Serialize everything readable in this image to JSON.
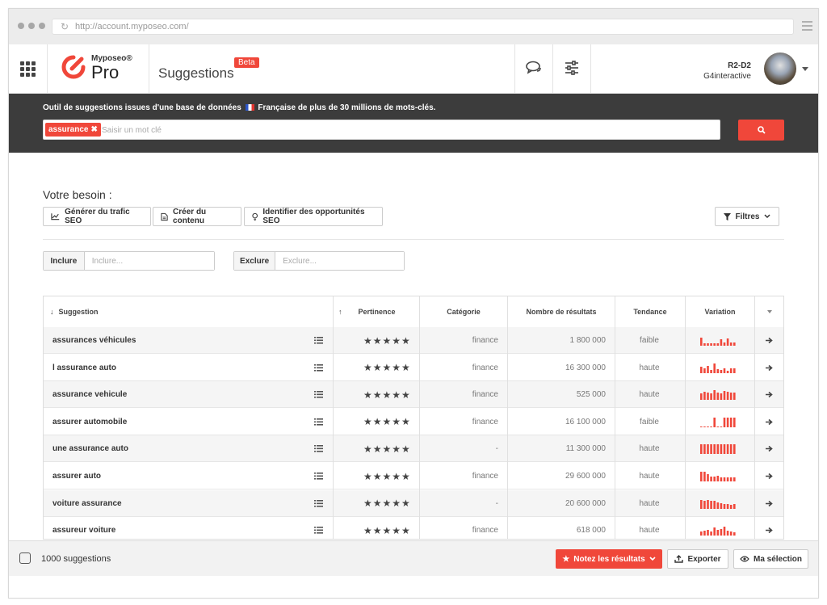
{
  "browser": {
    "url": "http://account.myposeo.com/"
  },
  "header": {
    "brand": "Myposeo®",
    "product": "Pro",
    "page_title": "Suggestions",
    "beta_badge": "Beta",
    "user_name": "R2-D2",
    "user_org": "G4interactive"
  },
  "search": {
    "description_before": "Outil de suggestions issues d'une base de données",
    "description_after": "Française de plus de 30 millions de mots-clés.",
    "tag": "assurance",
    "placeholder": "Saisir un mot clé"
  },
  "needs": {
    "title": "Votre besoin :",
    "buttons": [
      "Générer du trafic SEO",
      "Créer du contenu",
      "Identifier des opportunités SEO"
    ],
    "filters_label": "Filtres"
  },
  "filters": {
    "include_label": "Inclure",
    "include_placeholder": "Inclure...",
    "exclude_label": "Exclure",
    "exclude_placeholder": "Exclure..."
  },
  "table": {
    "columns": [
      "Suggestion",
      "Pertinence",
      "Catégorie",
      "Nombre de résultats",
      "Tendance",
      "Variation"
    ],
    "rows": [
      {
        "suggestion": "assurances véhicules",
        "stars": "★★★★★",
        "category": "finance",
        "results": "1 800 000",
        "trend": "faible",
        "variation": [
          10,
          3,
          3,
          3,
          3,
          3,
          8,
          4,
          9,
          4,
          4
        ]
      },
      {
        "suggestion": "l assurance auto",
        "stars": "★★★★★",
        "category": "finance",
        "results": "16 300 000",
        "trend": "haute",
        "variation": [
          8,
          6,
          9,
          4,
          12,
          5,
          4,
          6,
          3,
          6,
          6
        ]
      },
      {
        "suggestion": "assurance vehicule",
        "stars": "★★★★★",
        "category": "finance",
        "results": "525 000",
        "trend": "haute",
        "variation": [
          8,
          10,
          9,
          8,
          12,
          9,
          8,
          11,
          10,
          9,
          9
        ]
      },
      {
        "suggestion": "assurer automobile",
        "stars": "★★★★★",
        "category": "finance",
        "results": "16 100 000",
        "trend": "faible",
        "variation": [
          1,
          1,
          1,
          1,
          12,
          1,
          1,
          12,
          12,
          12,
          12
        ]
      },
      {
        "suggestion": "une assurance auto",
        "stars": "★★★★★",
        "category": "-",
        "results": "11 300 000",
        "trend": "haute",
        "variation": [
          12,
          12,
          12,
          12,
          12,
          12,
          12,
          12,
          12,
          12,
          12
        ]
      },
      {
        "suggestion": "assurer auto",
        "stars": "★★★★★",
        "category": "finance",
        "results": "29 600 000",
        "trend": "haute",
        "variation": [
          12,
          12,
          9,
          6,
          6,
          7,
          5,
          5,
          5,
          5,
          5
        ]
      },
      {
        "suggestion": "voiture assurance",
        "stars": "★★★★★",
        "category": "-",
        "results": "20 600 000",
        "trend": "haute",
        "variation": [
          11,
          10,
          11,
          10,
          10,
          8,
          7,
          6,
          6,
          5,
          6
        ]
      },
      {
        "suggestion": "assureur voiture",
        "stars": "★★★★★",
        "category": "finance",
        "results": "618 000",
        "trend": "haute",
        "variation": [
          5,
          6,
          7,
          5,
          10,
          7,
          8,
          11,
          6,
          5,
          4
        ]
      }
    ]
  },
  "footer": {
    "count": "1000 suggestions",
    "rate_label": "Notez les résultats",
    "export_label": "Exporter",
    "selection_label": "Ma sélection"
  },
  "colors": {
    "accent": "#f0473a",
    "band": "#3c3c3c"
  }
}
